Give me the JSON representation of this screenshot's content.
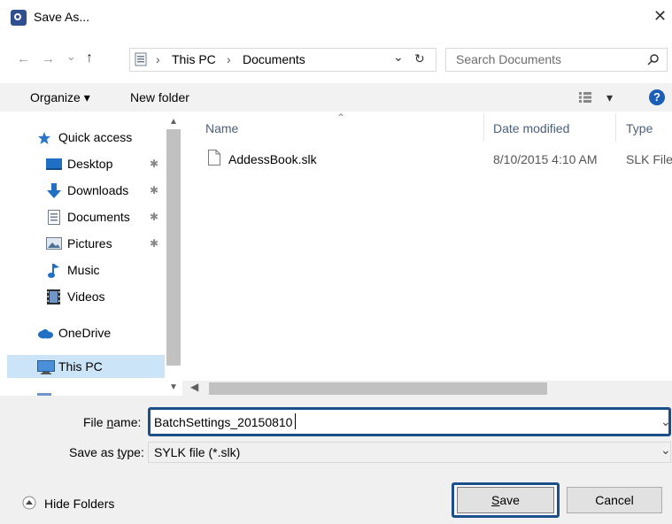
{
  "window": {
    "title": "Save As...",
    "close_glyph": "✕"
  },
  "nav": {
    "back_glyph": "←",
    "forward_glyph": "→",
    "recent_glyph": "⌄",
    "up_glyph": "↑",
    "breadcrumb": [
      "This PC",
      "Documents"
    ],
    "separator": "›",
    "dropdown_glyph": "⌄",
    "refresh_glyph": "↻",
    "search_placeholder": "Search Documents"
  },
  "toolbar": {
    "organize_label": "Organize ▾",
    "new_folder_label": "New folder",
    "view_caret": "▾",
    "help_label": "?"
  },
  "sidebar": {
    "items": [
      {
        "label": "Quick access",
        "icon": "star-icon"
      },
      {
        "label": "Desktop",
        "icon": "desktop-icon",
        "pinned": true
      },
      {
        "label": "Downloads",
        "icon": "download-icon",
        "pinned": true
      },
      {
        "label": "Documents",
        "icon": "documents-icon",
        "pinned": true
      },
      {
        "label": "Pictures",
        "icon": "pictures-icon",
        "pinned": true
      },
      {
        "label": "Music",
        "icon": "music-icon"
      },
      {
        "label": "Videos",
        "icon": "videos-icon"
      },
      {
        "label": "OneDrive",
        "icon": "onedrive-icon"
      },
      {
        "label": "This PC",
        "icon": "this-pc-icon",
        "selected": true
      }
    ],
    "pin_glyph": "✱"
  },
  "file_list": {
    "columns": [
      "Name",
      "Date modified",
      "Type"
    ],
    "sort_glyph": "⌃",
    "rows": [
      {
        "name": "AddessBook.slk",
        "date": "8/10/2015 4:10 AM",
        "type": "SLK File"
      }
    ]
  },
  "form": {
    "file_name_label": {
      "pre": "File ",
      "accel": "n",
      "post": "ame:"
    },
    "file_name_value": "BatchSettings_20150810",
    "save_type_label": {
      "pre": "Save as ",
      "accel": "t",
      "post": "ype:"
    },
    "save_type_value": "SYLK file (*.slk)",
    "hide_folders": "Hide Folders",
    "save_label": {
      "accel": "S",
      "rest": "ave"
    },
    "cancel_label": "Cancel"
  },
  "colors": {
    "accent": "#1a4f8a",
    "selection": "#cce4f7",
    "column_header": "#4c607a"
  }
}
